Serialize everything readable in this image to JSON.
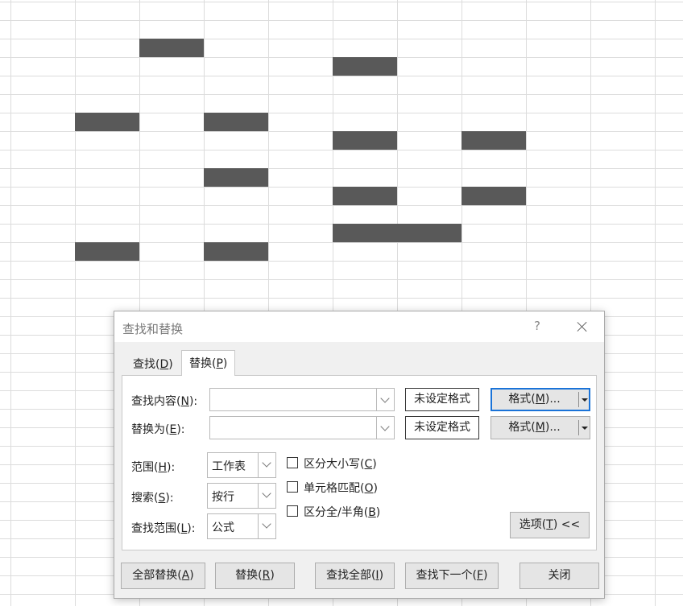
{
  "dialog": {
    "title": "查找和替换",
    "help": "?",
    "tabs": [
      {
        "label": "查找(",
        "key": "D",
        "suffix": ")"
      },
      {
        "label": "替换(",
        "key": "P",
        "suffix": ")"
      }
    ],
    "find": {
      "label": "查找内容(",
      "key": "N",
      "suffix": "):",
      "value": "",
      "format_status": "未设定格式",
      "format_button": "格式(",
      "format_key": "M",
      "format_suffix": ")..."
    },
    "replace": {
      "label": "替换为(",
      "key": "E",
      "suffix": "):",
      "value": "",
      "format_status": "未设定格式",
      "format_button": "格式(",
      "format_key": "M",
      "format_suffix": ")..."
    },
    "scope": {
      "label": "范围(",
      "key": "H",
      "suffix": "):",
      "value": "工作表"
    },
    "search": {
      "label": "搜索(",
      "key": "S",
      "suffix": "):",
      "value": "按行"
    },
    "lookin": {
      "label": "查找范围(",
      "key": "L",
      "suffix": "):",
      "value": "公式"
    },
    "checkboxes": [
      {
        "label": "区分大小写(",
        "key": "C",
        "suffix": ")",
        "checked": false
      },
      {
        "label": "单元格匹配(",
        "key": "O",
        "suffix": ")",
        "checked": false
      },
      {
        "label": "区分全/半角(",
        "key": "B",
        "suffix": ")",
        "checked": false
      }
    ],
    "options_button": {
      "label": "选项(",
      "key": "T",
      "suffix": ") <<"
    },
    "buttons": {
      "replace_all": {
        "label": "全部替换(",
        "key": "A",
        "suffix": ")"
      },
      "replace": {
        "label": "替换(",
        "key": "R",
        "suffix": ")"
      },
      "find_all": {
        "label": "查找全部(",
        "key": "I",
        "suffix": ")"
      },
      "find_next": {
        "label": "查找下一个(",
        "key": "F",
        "suffix": ")"
      },
      "close": {
        "label": "关闭"
      }
    }
  },
  "sheet": {
    "fill_color": "#595959",
    "grid_color": "#dcdcdc"
  }
}
